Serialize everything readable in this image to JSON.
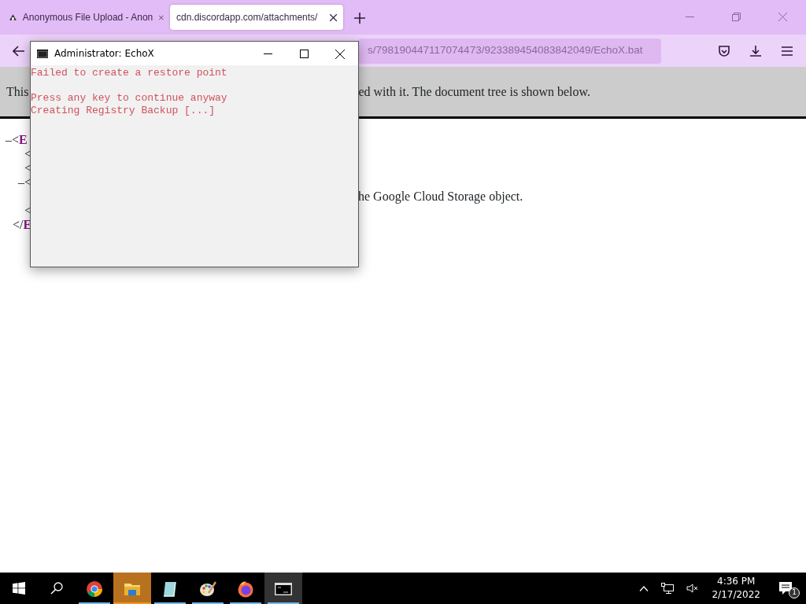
{
  "browser": {
    "tabs": [
      {
        "label": "Anonymous File Upload - Anon",
        "selected": false
      },
      {
        "label": "cdn.discordapp.com/attachments/",
        "selected": true
      }
    ],
    "address": "s/798190447117074473/923389454083842049/EchoX.bat"
  },
  "page": {
    "banner_left": "This",
    "banner_right": "ed with it. The document tree is shown below.",
    "tree": {
      "prefix": "–<",
      "tag": "E",
      "close_prefix": "</",
      "close_tag": "E",
      "children": [
        {
          "kind": "node",
          "prefix": "<"
        },
        {
          "kind": "node",
          "prefix": "<"
        },
        {
          "kind": "node",
          "prefix": "–<",
          "children": [
            {
              "kind": "text",
              "text": "he Google Cloud Storage object."
            }
          ]
        },
        {
          "kind": "node",
          "prefix": "<"
        }
      ]
    }
  },
  "console": {
    "title": "Administrator:  EchoX",
    "blocks": [
      [
        "Failed to create a restore point"
      ],
      [
        "Press any key to continue anyway",
        "Creating Registry Backup [...]"
      ]
    ]
  },
  "taskbar": {
    "apps": [
      {
        "kind": "chrome",
        "running": true,
        "flashing": false,
        "selected": false
      },
      {
        "kind": "folder",
        "running": true,
        "flashing": true,
        "selected": false
      },
      {
        "kind": "notepad",
        "running": true,
        "flashing": false,
        "selected": false
      },
      {
        "kind": "paint",
        "running": true,
        "flashing": false,
        "selected": false
      },
      {
        "kind": "firefox",
        "running": true,
        "flashing": false,
        "selected": false
      },
      {
        "kind": "console",
        "running": true,
        "flashing": false,
        "selected": true
      }
    ],
    "time": "4:36 PM",
    "date": "2/17/2022",
    "notifications": "1"
  }
}
